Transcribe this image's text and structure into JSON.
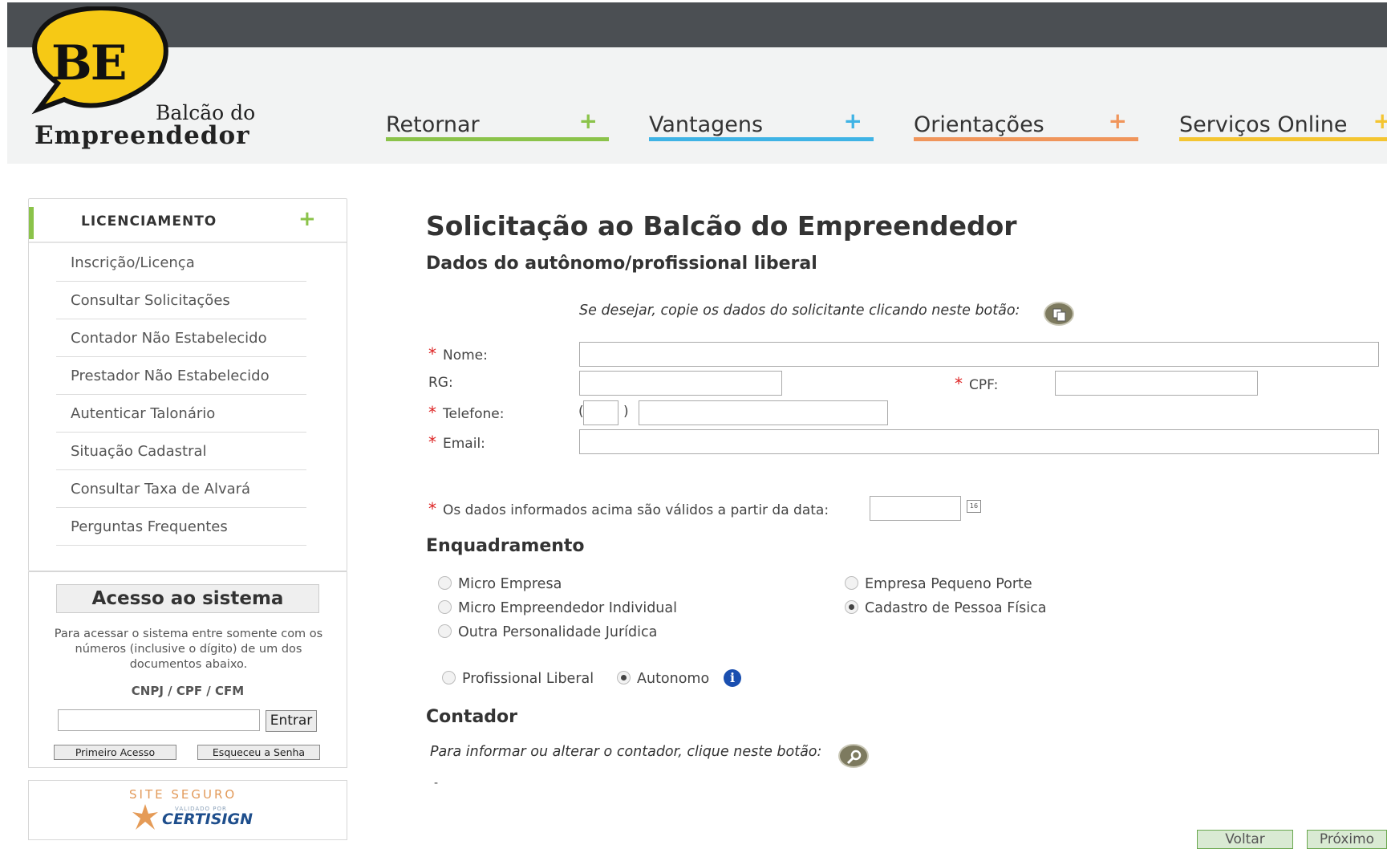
{
  "logo": {
    "mark": "BE",
    "line1": "Balcão do",
    "line2": "Empreendedor"
  },
  "nav": [
    {
      "label": "Retornar",
      "color": "#8bc34a"
    },
    {
      "label": "Vantagens",
      "color": "#3fb3e5"
    },
    {
      "label": "Orientações",
      "color": "#f0955b"
    },
    {
      "label": "Serviços Online",
      "color": "#f4c531"
    }
  ],
  "nav_plus": "+",
  "sidebar": {
    "title": "LICENCIAMENTO",
    "plus": "+",
    "items": [
      "Inscrição/Licença",
      "Consultar Solicitações",
      "Contador Não Estabelecido",
      "Prestador Não Estabelecido",
      "Autenticar Talonário",
      "Situação Cadastral",
      "Consultar Taxa de Alvará",
      "Perguntas Frequentes"
    ]
  },
  "access": {
    "title": "Acesso ao sistema",
    "description": "Para acessar o sistema entre somente com os números (inclusive o dígito) de um dos documentos abaixo.",
    "documents": "CNPJ / CPF / CFM",
    "input_value": "",
    "enter_label": "Entrar",
    "first_access_label": "Primeiro Acesso",
    "forgot_label": "Esqueceu a Senha"
  },
  "secure": {
    "line1": "SITE SEGURO",
    "line2": "VALIDADO POR",
    "line3": "CERTISIGN"
  },
  "main": {
    "title": "Solicitação ao Balcão do Empreendedor",
    "subtitle": "Dados do autônomo/profissional liberal",
    "copy_hint": "Se desejar, copie os dados do solicitante clicando neste botão:",
    "required_mark": "*",
    "fields": {
      "nome": {
        "label": "Nome:",
        "value": ""
      },
      "rg": {
        "label": "RG:",
        "value": ""
      },
      "cpf": {
        "label": "CPF:",
        "value": ""
      },
      "telefone": {
        "label": "Telefone:",
        "ddd": "",
        "number": "",
        "open_paren": "(",
        "close_paren": ")"
      },
      "email": {
        "label": "Email:",
        "value": ""
      },
      "valid_date": {
        "label": "Os dados informados acima são válidos a partir da data:",
        "value": "",
        "calendar_text": "16"
      }
    },
    "enquadramento": {
      "title": "Enquadramento",
      "options_left": [
        "Micro Empresa",
        "Micro Empreendedor Individual",
        "Outra Personalidade Jurídica"
      ],
      "options_right": [
        "Empresa Pequeno Porte",
        "Cadastro de Pessoa Física"
      ],
      "selected": "Cadastro de Pessoa Física",
      "sub_options": [
        "Profissional Liberal",
        "Autonomo"
      ],
      "sub_selected": "Autonomo",
      "info_glyph": "i"
    },
    "contador": {
      "title": "Contador",
      "hint": "Para informar ou alterar o contador, clique neste botão:",
      "dash": "-"
    },
    "buttons": {
      "back": "Voltar",
      "next": "Próximo"
    }
  }
}
